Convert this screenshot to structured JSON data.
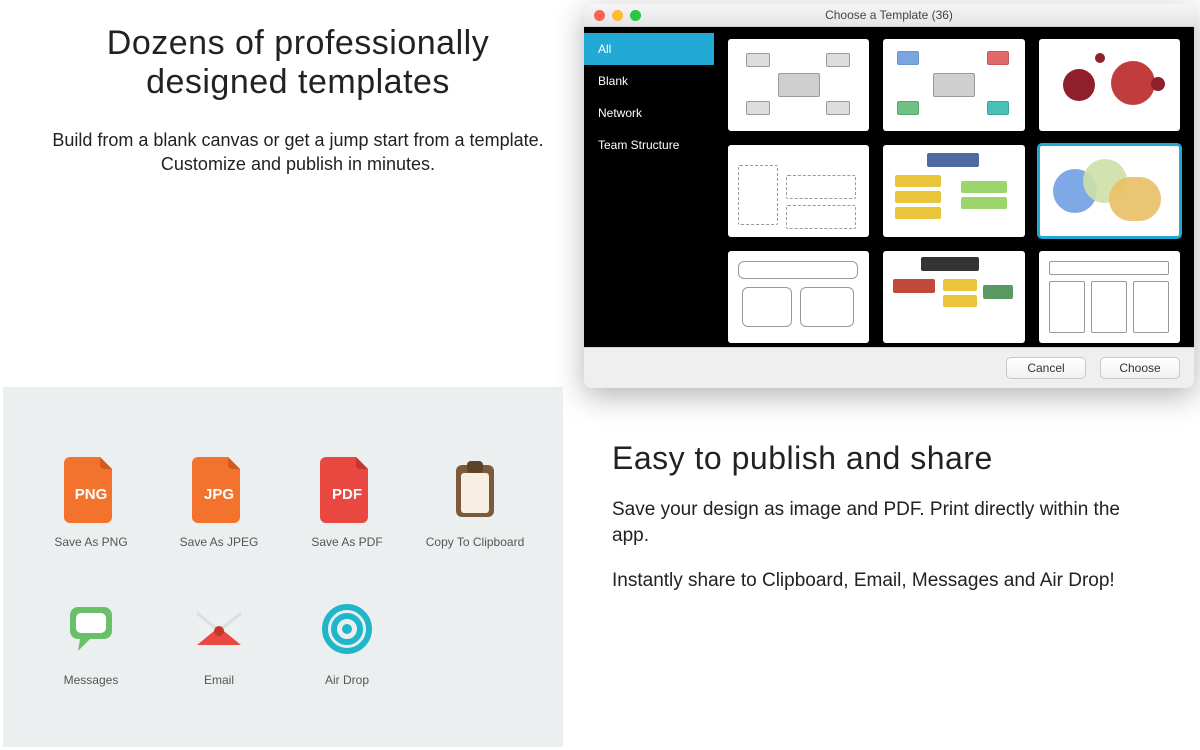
{
  "hero": {
    "title_line1": "Dozens of professionally",
    "title_line2": "designed templates",
    "body_line1": "Build from a blank canvas or get a jump start from a template.",
    "body_line2": "Customize and publish in minutes."
  },
  "chooser": {
    "window_title": "Choose a Template (36)",
    "sidebar": {
      "items": [
        {
          "label": "All",
          "active": true
        },
        {
          "label": "Blank",
          "active": false
        },
        {
          "label": "Network",
          "active": false
        },
        {
          "label": "Team Structure",
          "active": false
        }
      ]
    },
    "buttons": {
      "cancel": "Cancel",
      "choose": "Choose"
    },
    "selected_index": 5
  },
  "share": {
    "items": [
      {
        "name": "save-as-png",
        "label": "Save As PNG",
        "badge": "PNG",
        "icon": "file-png"
      },
      {
        "name": "save-as-jpeg",
        "label": "Save As JPEG",
        "badge": "JPG",
        "icon": "file-jpg"
      },
      {
        "name": "save-as-pdf",
        "label": "Save As PDF",
        "badge": "PDF",
        "icon": "file-pdf"
      },
      {
        "name": "copy-clipboard",
        "label": "Copy To Clipboard",
        "icon": "clipboard"
      },
      {
        "name": "messages",
        "label": "Messages",
        "icon": "messages"
      },
      {
        "name": "email",
        "label": "Email",
        "icon": "email"
      },
      {
        "name": "airdrop",
        "label": "Air Drop",
        "icon": "airdrop"
      }
    ]
  },
  "publish": {
    "title": "Easy to publish and share",
    "p1": "Save your design as image and PDF. Print directly within the app.",
    "p2": "Instantly share to Clipboard, Email, Messages and Air Drop!"
  },
  "colors": {
    "orange": "#f3722c",
    "red": "#e8483f",
    "teal": "#1fb6c9",
    "green": "#6ac06a",
    "brown": "#7b5a3c",
    "accent": "#22a9d6"
  }
}
